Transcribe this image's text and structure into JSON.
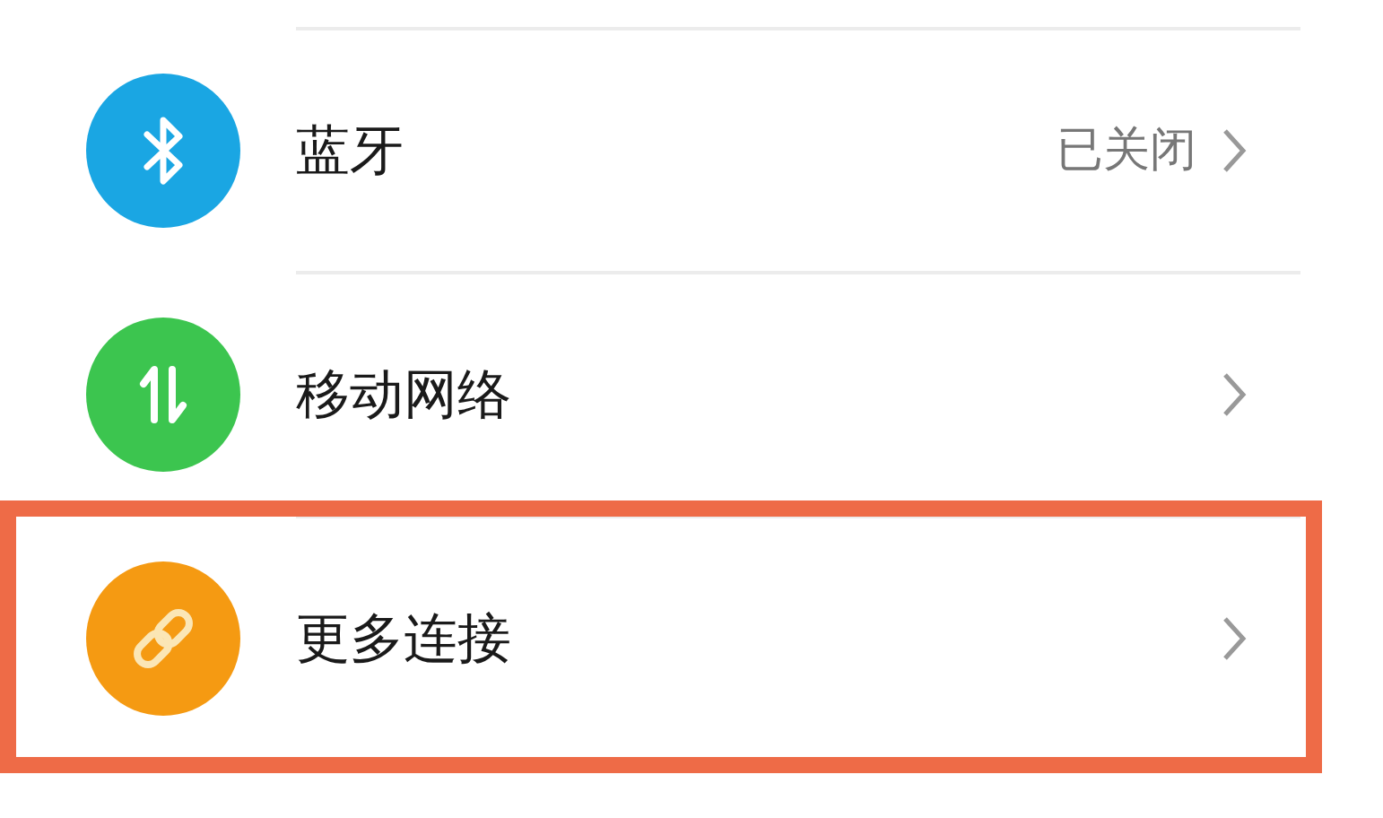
{
  "items": [
    {
      "kind": "bluetooth",
      "color": "#1aa6e3",
      "label": "蓝牙",
      "status": "已关闭",
      "highlighted": false
    },
    {
      "kind": "mobile-data",
      "color": "#3cc54f",
      "label": "移动网络",
      "highlighted": false
    },
    {
      "kind": "link",
      "color": "#f59a12",
      "label": "更多连接",
      "highlighted": true
    }
  ]
}
